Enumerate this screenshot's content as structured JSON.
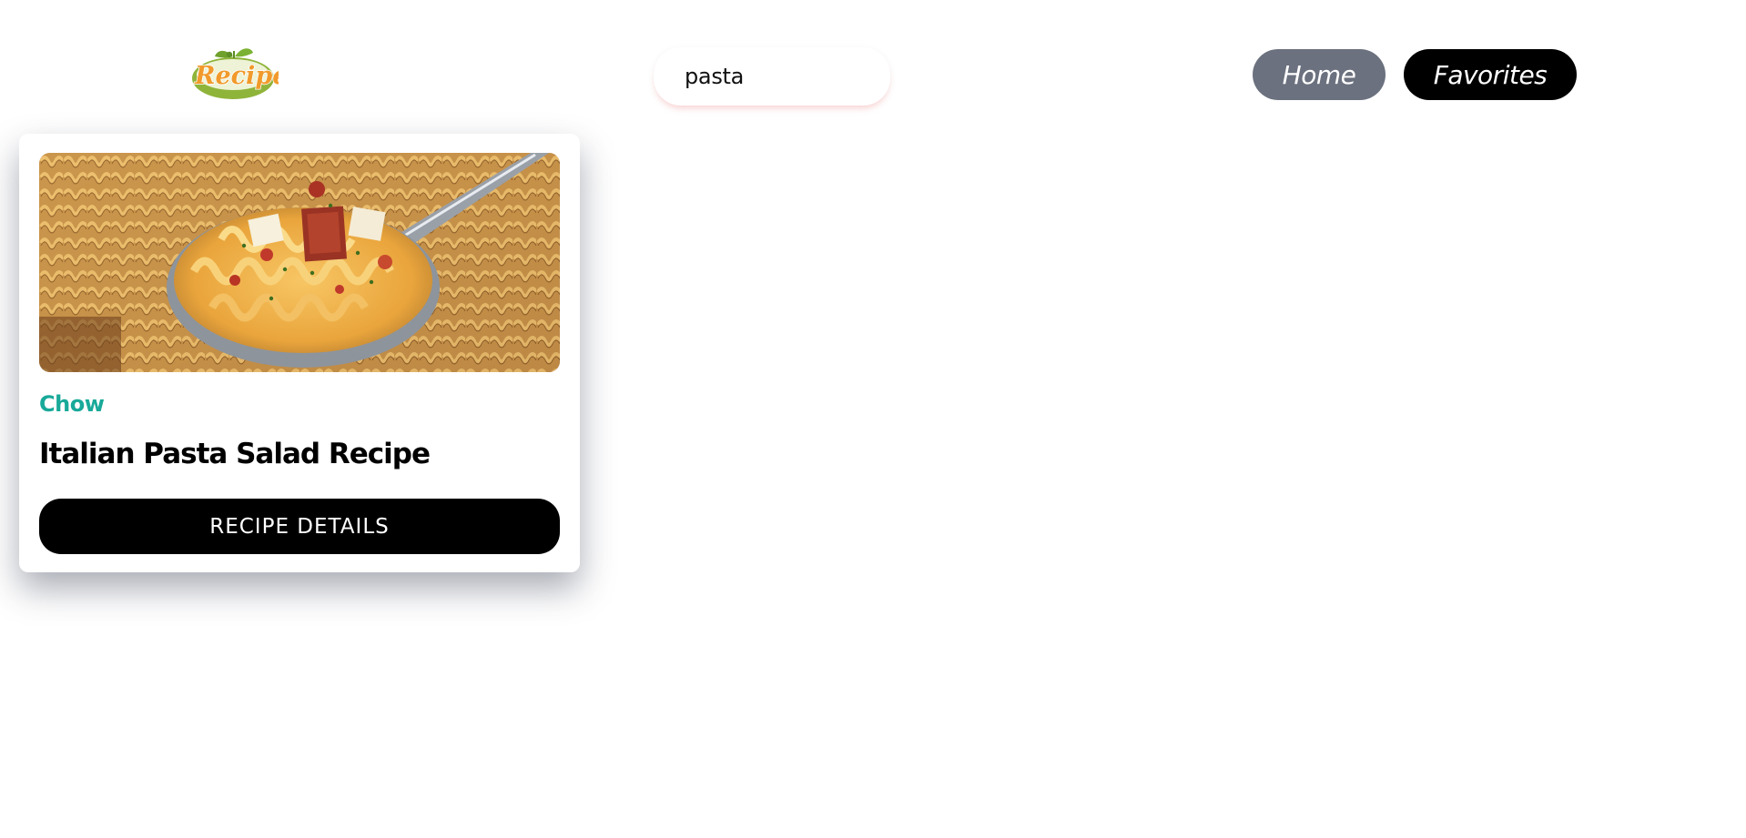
{
  "header": {
    "logo_text": "Recipe",
    "search": {
      "value": "pasta"
    },
    "nav": {
      "home_label": "Home",
      "favorites_label": "Favorites"
    }
  },
  "results": [
    {
      "image_icon": "pasta-photo",
      "source": "Chow",
      "title": "Italian Pasta Salad Recipe",
      "button_label": "RECIPE DETAILS"
    }
  ],
  "colors": {
    "home_bg": "#6b717e",
    "favorites_bg": "#000000",
    "source_text": "#18a999",
    "logo_orange": "#f19a2b",
    "logo_green": "#8fb43a",
    "button_bg": "#000000"
  }
}
